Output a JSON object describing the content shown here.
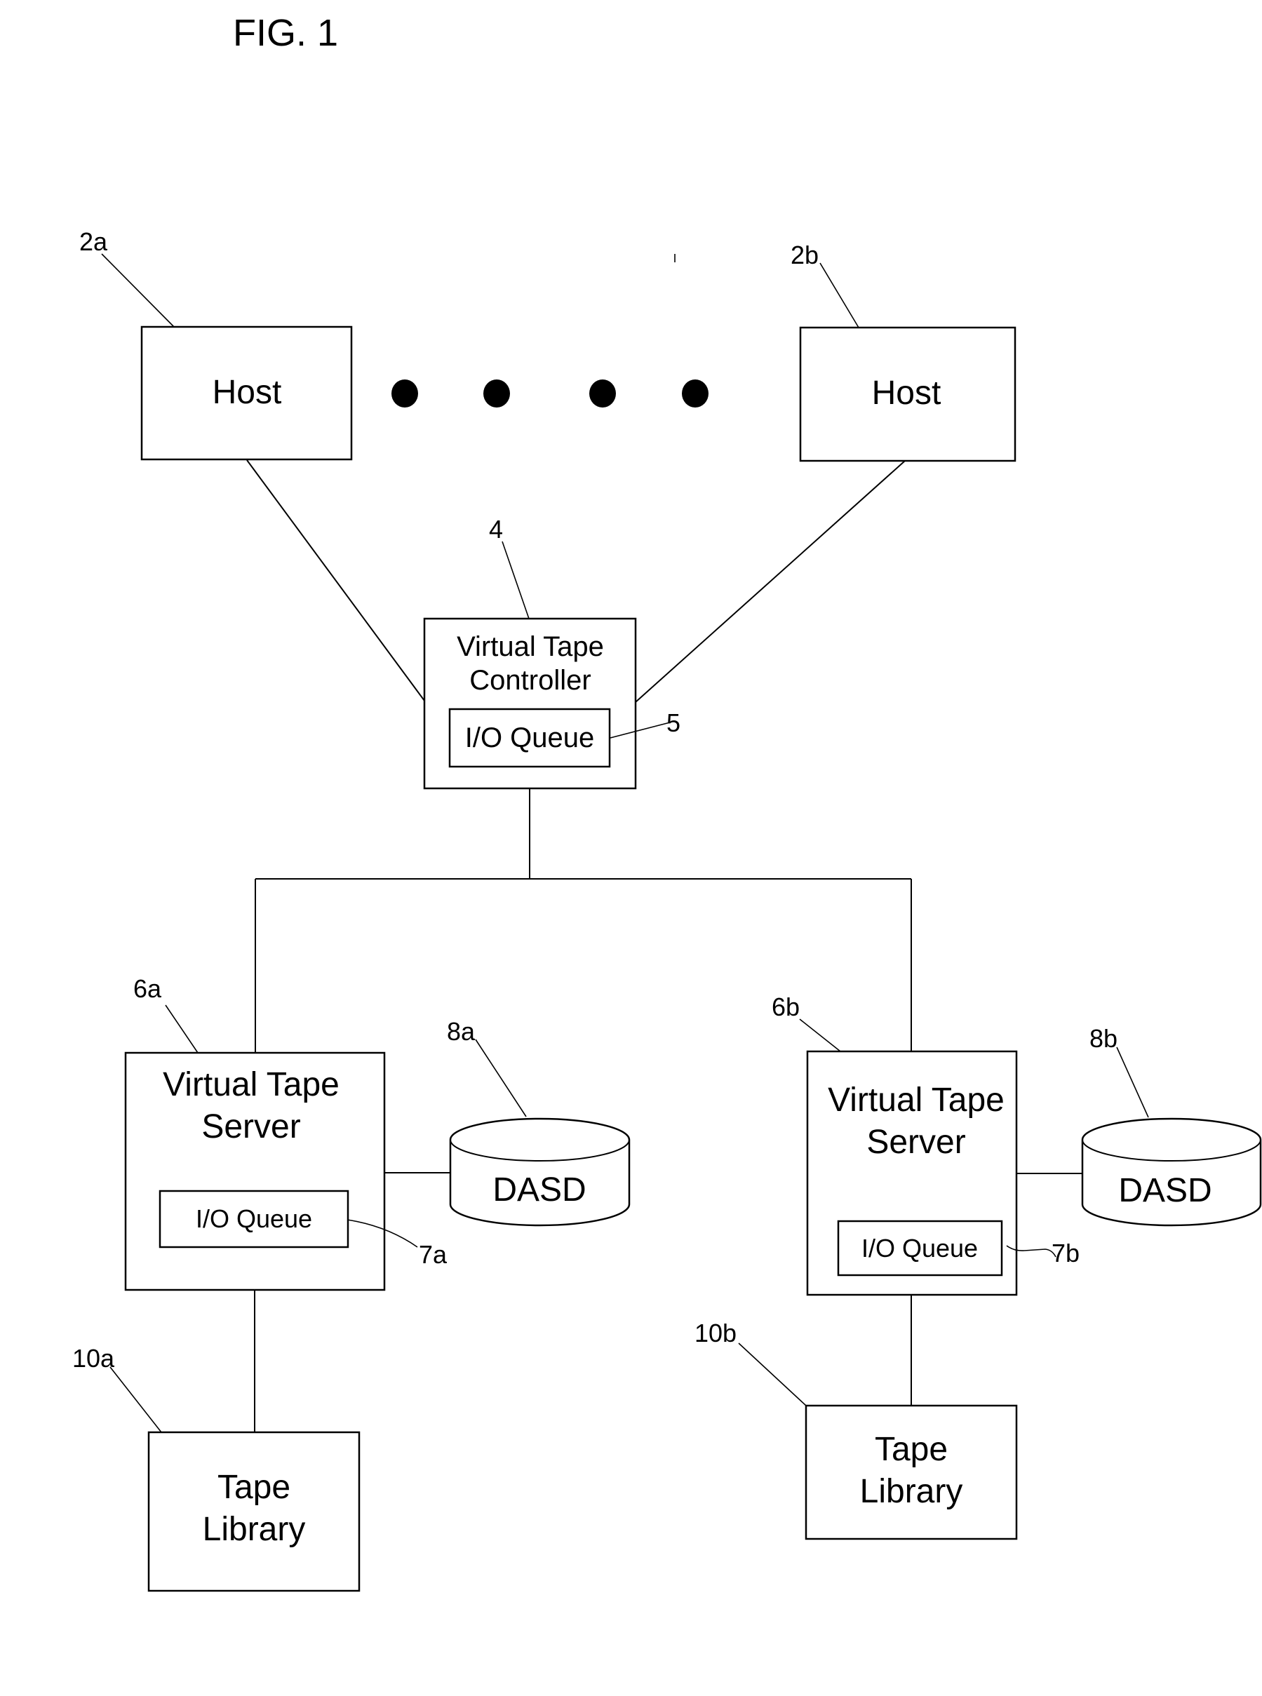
{
  "figure": {
    "title": "FIG. 1"
  },
  "hosts": [
    {
      "ref": "2a",
      "label": "Host"
    },
    {
      "ref": "2b",
      "label": "Host"
    }
  ],
  "ellipsis_dots": 4,
  "controller": {
    "ref": "4",
    "label_line1": "Virtual Tape",
    "label_line2": "Controller",
    "queue": {
      "ref": "5",
      "label": "I/O Queue"
    }
  },
  "servers": [
    {
      "ref": "6a",
      "label_line1": "Virtual Tape",
      "label_line2": "Server",
      "queue": {
        "ref": "7a",
        "label": "I/O Queue"
      },
      "dasd": {
        "ref": "8a",
        "label": "DASD"
      },
      "library": {
        "ref": "10a",
        "label_line1": "Tape",
        "label_line2": "Library"
      }
    },
    {
      "ref": "6b",
      "label_line1": "Virtual Tape",
      "label_line2": "Server",
      "queue": {
        "ref": "7b",
        "label": "I/O Queue"
      },
      "dasd": {
        "ref": "8b",
        "label": "DASD"
      },
      "library": {
        "ref": "10b",
        "label_line1": "Tape",
        "label_line2": "Library"
      }
    }
  ]
}
